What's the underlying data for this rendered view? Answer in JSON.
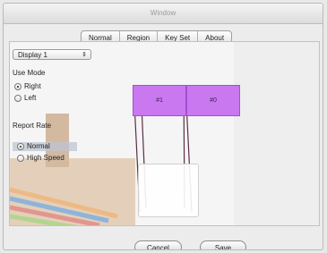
{
  "window": {
    "title": "Window"
  },
  "tabs": [
    "Normal",
    "Region",
    "Key Set",
    "About"
  ],
  "display_select": {
    "value": "Display 1"
  },
  "use_mode": {
    "label": "Use Mode",
    "options": [
      {
        "label": "Right",
        "selected": true
      },
      {
        "label": "Left",
        "selected": false
      }
    ]
  },
  "report_rate": {
    "label": "Report Rate",
    "options": [
      {
        "label": "Normal",
        "selected": true
      },
      {
        "label": "High Speed",
        "selected": false
      }
    ]
  },
  "monitors": {
    "m1": "#1",
    "m0": "#0"
  },
  "buttons": {
    "cancel": "Cancel",
    "save": "Save"
  },
  "colors": {
    "monitor_fill": "#c978f0",
    "monitor_border": "#a24fd3"
  }
}
